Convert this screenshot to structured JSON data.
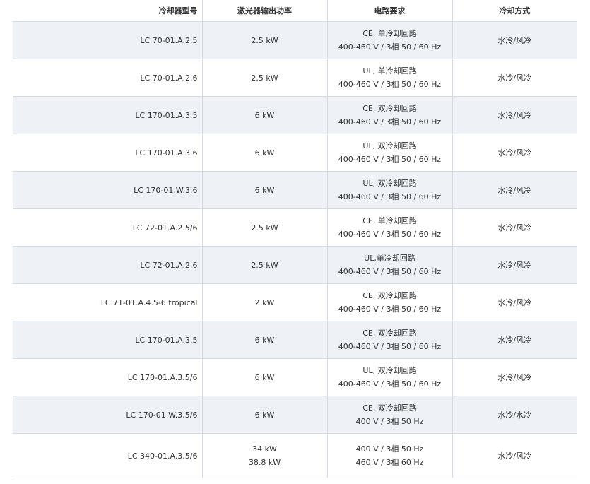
{
  "table": {
    "headers": [
      "冷却器型号",
      "激光器输出功率",
      "电路要求",
      "冷却方式"
    ],
    "rows": [
      {
        "model": "LC 70-01.A.2.5",
        "power": [
          "2.5 kW"
        ],
        "circuit": [
          "CE, 单冷却回路",
          "400-460 V / 3相 50 / 60 Hz"
        ],
        "cooling": "水冷/风冷"
      },
      {
        "model": "LC 70-01.A.2.6",
        "power": [
          "2.5 kW"
        ],
        "circuit": [
          "UL, 单冷却回路",
          "400-460 V / 3相 50 / 60 Hz"
        ],
        "cooling": "水冷/风冷"
      },
      {
        "model": "LC 170-01.A.3.5",
        "power": [
          "6 kW"
        ],
        "circuit": [
          "CE, 双冷却回路",
          "400-460 V / 3相 50 / 60 Hz"
        ],
        "cooling": "水冷/风冷"
      },
      {
        "model": "LC 170-01.A.3.6",
        "power": [
          "6 kW"
        ],
        "circuit": [
          "UL, 双冷却回路",
          "400-460 V / 3相 50 / 60 Hz"
        ],
        "cooling": "水冷/风冷"
      },
      {
        "model": "LC 170-01.W.3.6",
        "power": [
          "6 kW"
        ],
        "circuit": [
          "UL, 双冷却回路",
          "400-460 V / 3相 50 / 60 Hz"
        ],
        "cooling": "水冷/风冷"
      },
      {
        "model": "LC 72-01.A.2.5/6",
        "power": [
          "2.5 kW"
        ],
        "circuit": [
          "CE, 单冷却回路",
          "400-460 V / 3相 50 / 60 Hz"
        ],
        "cooling": "水冷/风冷"
      },
      {
        "model": "LC 72-01.A.2.6",
        "power": [
          "2.5 kW"
        ],
        "circuit": [
          "UL,单冷却回路",
          "400-460 V / 3相 50 / 60 Hz"
        ],
        "cooling": "水冷/风冷"
      },
      {
        "model": "LC 71-01.A.4.5-6 tropical",
        "power": [
          "2 kW"
        ],
        "circuit": [
          "CE, 双冷却回路",
          "400-460 V / 3相 50 / 60 Hz"
        ],
        "cooling": "水冷/风冷"
      },
      {
        "model": "LC 170-01.A.3.5",
        "power": [
          "6 kW"
        ],
        "circuit": [
          "CE, 双冷却回路",
          "400-460 V / 3相 50 / 60 Hz"
        ],
        "cooling": "水冷/风冷"
      },
      {
        "model": "LC 170-01.A.3.5/6",
        "power": [
          "6 kW"
        ],
        "circuit": [
          "UL, 双冷却回路",
          "400-460 V / 3相 50 / 60 Hz"
        ],
        "cooling": "水冷/风冷"
      },
      {
        "model": "LC 170-01.W.3.5/6",
        "power": [
          "6 kW"
        ],
        "circuit": [
          "CE, 双冷却回路",
          "400 V / 3相 50 Hz"
        ],
        "cooling": "水冷/水冷"
      },
      {
        "model": "LC 340-01.A.3.5/6",
        "power": [
          "34 kW",
          "38.8 kW"
        ],
        "circuit": [
          "400 V / 3相 50 Hz",
          "460 V / 3相 60 Hz"
        ],
        "cooling": "水冷/风冷"
      }
    ]
  }
}
